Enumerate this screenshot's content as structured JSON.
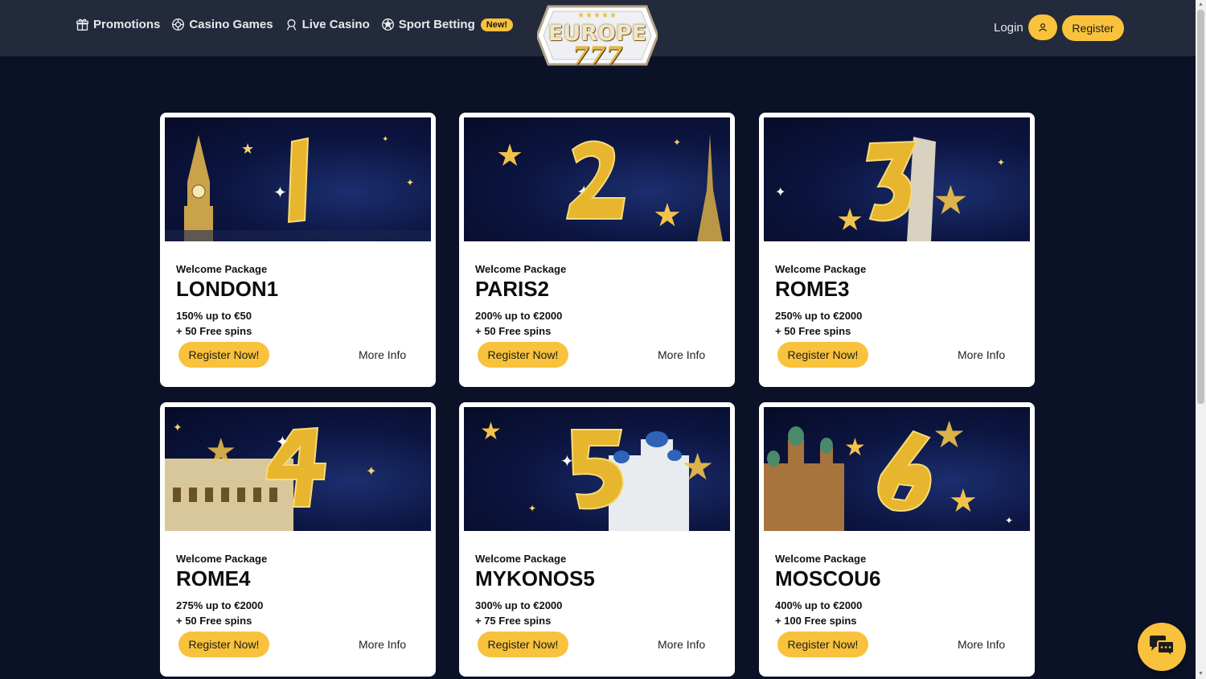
{
  "header": {
    "nav": [
      {
        "label": "Promotions",
        "icon": "gift-icon"
      },
      {
        "label": "Casino Games",
        "icon": "chip-icon"
      },
      {
        "label": "Live Casino",
        "icon": "dealer-icon"
      },
      {
        "label": "Sport Betting",
        "icon": "soccer-ball-icon"
      }
    ],
    "new_badge": "New!",
    "logo_top": "EUROPE",
    "logo_bottom": "777",
    "logo_stars": "★★★★★",
    "login_label": "Login",
    "register_label": "Register"
  },
  "cards": [
    {
      "subtitle": "Welcome Package",
      "code": "LONDON1",
      "line1": "150% up to €50",
      "line2": "+ 50 Free spins",
      "register": "Register Now!",
      "more": "More Info",
      "digit": "1"
    },
    {
      "subtitle": "Welcome Package",
      "code": "PARIS2",
      "line1": "200% up to €2000",
      "line2": "+ 50 Free spins",
      "register": "Register Now!",
      "more": "More Info",
      "digit": "2"
    },
    {
      "subtitle": "Welcome Package",
      "code": "ROME3",
      "line1": "250% up to €2000",
      "line2": "+ 50 Free spins",
      "register": "Register Now!",
      "more": "More Info",
      "digit": "3"
    },
    {
      "subtitle": "Welcome Package",
      "code": "ROME4",
      "line1": "275% up to €2000",
      "line2": "+ 50 Free spins",
      "register": "Register Now!",
      "more": "More Info",
      "digit": "4"
    },
    {
      "subtitle": "Welcome Package",
      "code": "MYKONOS5",
      "line1": "300% up to €2000",
      "line2": "+ 75 Free spins",
      "register": "Register Now!",
      "more": "More Info",
      "digit": "5"
    },
    {
      "subtitle": "Welcome Package",
      "code": "MOSCOU6",
      "line1": "400% up to €2000",
      "line2": "+ 100 Free spins",
      "register": "Register Now!",
      "more": "More Info",
      "digit": "6"
    }
  ],
  "colors": {
    "accent": "#f9c23c",
    "header_bg": "#232a3b",
    "page_bg": "#0b1127"
  },
  "chat_icon": "chat-bubbles-icon"
}
